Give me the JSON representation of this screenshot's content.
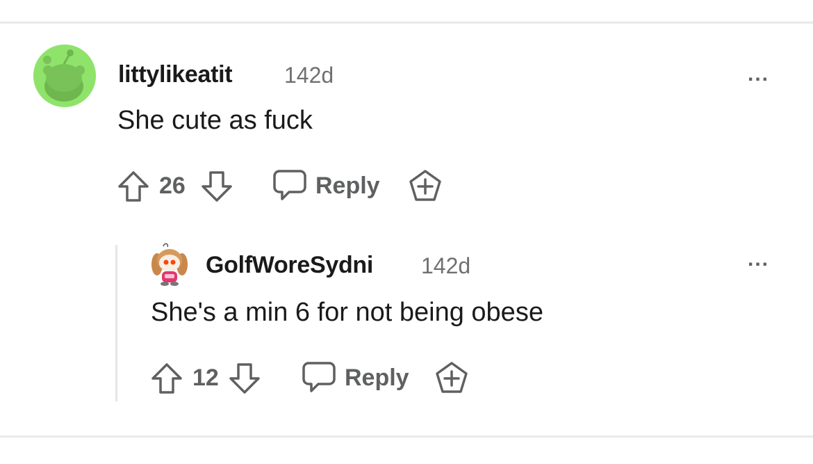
{
  "comment": {
    "username": "littylikeatit",
    "age": "142d",
    "text": "She cute as fuck",
    "score": "26",
    "reply_label": "Reply",
    "more_label": "..."
  },
  "reply": {
    "username": "GolfWoreSydni",
    "age": "142d",
    "text": "She's a min 6 for not being obese",
    "score": "12",
    "reply_label": "Reply",
    "more_label": "..."
  },
  "colors": {
    "avatar_bg": "#8fe36b",
    "icon_gray": "#5f6061",
    "text": "#1a1a1b"
  },
  "icons": [
    "upvote-icon",
    "downvote-icon",
    "comment-bubble-icon",
    "award-icon",
    "more-options-icon"
  ]
}
